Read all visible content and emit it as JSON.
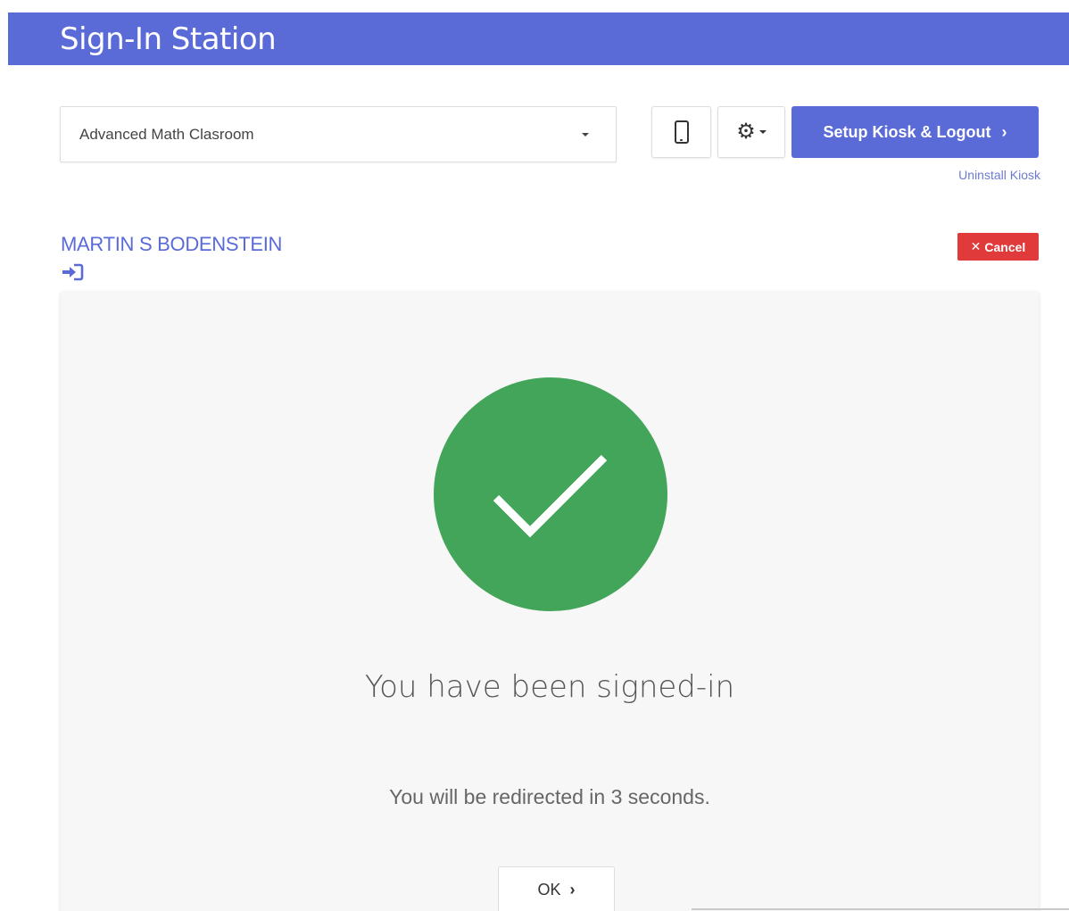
{
  "header": {
    "title": "Sign-In Station",
    "bg_color": "#5a6bd8"
  },
  "toolbar": {
    "room_select_value": "Advanced Math Clasroom",
    "mobile_icon": "mobile-phone-icon",
    "settings_icon": "gear-icon",
    "setup_label": "Setup Kiosk & Logout",
    "setup_chevron": "›",
    "uninstall_label": "Uninstall Kiosk"
  },
  "user": {
    "name": "MARTIN S BODENSTEIN",
    "icon": "sign-in-icon"
  },
  "cancel": {
    "icon": "✕",
    "label": "Cancel",
    "color": "#e03a3a"
  },
  "result": {
    "icon": "checkmark-icon",
    "circle_color": "#43a55a",
    "message": "You have been signed-in",
    "redirect": "You will be redirected in 3 seconds.",
    "ok_label": "OK",
    "ok_chevron": "›"
  }
}
